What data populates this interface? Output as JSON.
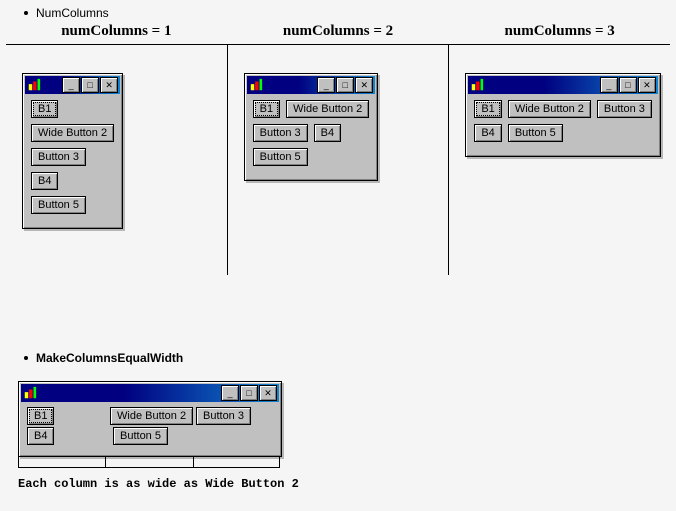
{
  "bullets": {
    "num_columns": "NumColumns",
    "make_equal": "MakeColumnsEqualWidth"
  },
  "headers": {
    "c1": "numColumns = 1",
    "c2": "numColumns = 2",
    "c3": "numColumns = 3"
  },
  "buttons": {
    "b1": "B1",
    "wide2": "Wide Button 2",
    "b3": "Button 3",
    "b4": "B4",
    "b5": "Button 5"
  },
  "winctl": {
    "min": "_",
    "max": "□",
    "close": "✕"
  },
  "caption": "Each column is as wide as Wide Button 2"
}
